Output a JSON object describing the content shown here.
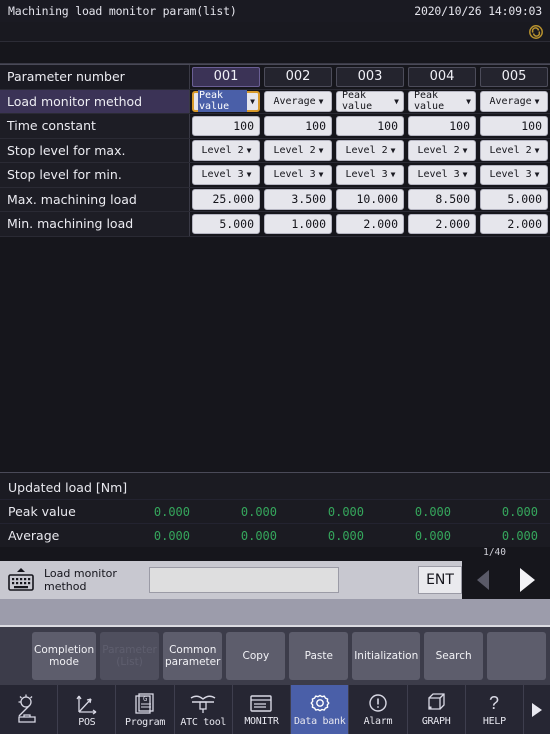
{
  "header": {
    "title": "Machining load monitor param(list)",
    "datetime": "2020/10/26 14:09:03",
    "badge_icon": "swirl-icon"
  },
  "table": {
    "row_labels": [
      "Parameter number",
      "Load monitor method",
      "Time constant",
      "Stop level for max.",
      "Stop level for min.",
      "Max. machining load",
      "Min. machining load"
    ],
    "columns": [
      {
        "number": "001",
        "selected": true,
        "load_monitor_method": "Peak value",
        "time_constant": "100",
        "stop_level_max": "Level 2",
        "stop_level_min": "Level 3",
        "max_machining_load": "25.000",
        "min_machining_load": "5.000"
      },
      {
        "number": "002",
        "selected": false,
        "load_monitor_method": "Average",
        "time_constant": "100",
        "stop_level_max": "Level 2",
        "stop_level_min": "Level 3",
        "max_machining_load": "3.500",
        "min_machining_load": "1.000"
      },
      {
        "number": "003",
        "selected": false,
        "load_monitor_method": "Peak value",
        "time_constant": "100",
        "stop_level_max": "Level 2",
        "stop_level_min": "Level 3",
        "max_machining_load": "10.000",
        "min_machining_load": "2.000"
      },
      {
        "number": "004",
        "selected": false,
        "load_monitor_method": "Peak value",
        "time_constant": "100",
        "stop_level_max": "Level 2",
        "stop_level_min": "Level 3",
        "max_machining_load": "8.500",
        "min_machining_load": "2.000"
      },
      {
        "number": "005",
        "selected": false,
        "load_monitor_method": "Average",
        "time_constant": "100",
        "stop_level_max": "Level 2",
        "stop_level_min": "Level 3",
        "max_machining_load": "5.000",
        "min_machining_load": "2.000"
      }
    ]
  },
  "updated_load": {
    "title": "Updated load [Nm]",
    "rows": [
      {
        "label": "Peak value",
        "values": [
          "0.000",
          "0.000",
          "0.000",
          "0.000",
          "0.000"
        ]
      },
      {
        "label": "Average",
        "values": [
          "0.000",
          "0.000",
          "0.000",
          "0.000",
          "0.000"
        ]
      }
    ],
    "value_color": "#35a65c"
  },
  "pager": {
    "indicator": "1/40"
  },
  "input_bar": {
    "keyboard_icon": "keyboard-icon",
    "label": "Load monitor method",
    "value": "",
    "placeholder": "",
    "enter_label": "ENT",
    "prev_icon": "arrow-left-icon",
    "next_icon": "arrow-right-icon"
  },
  "function_buttons": [
    {
      "label": "Completion mode",
      "disabled": false
    },
    {
      "label": "Parameter (List)",
      "disabled": true
    },
    {
      "label": "Common parameter",
      "disabled": false
    },
    {
      "label": "Copy",
      "disabled": false
    },
    {
      "label": "Paste",
      "disabled": false
    },
    {
      "label": "Initialization",
      "disabled": false
    },
    {
      "label": "Search",
      "disabled": false
    },
    {
      "label": "",
      "disabled": false
    }
  ],
  "nav_items": [
    {
      "label": "",
      "icon": "lamp-tool-icon",
      "active": false
    },
    {
      "label": "POS",
      "icon": "axes-icon",
      "active": false
    },
    {
      "label": "Program",
      "icon": "program-icon",
      "active": false
    },
    {
      "label": "ATC tool",
      "icon": "atc-tool-icon",
      "active": false
    },
    {
      "label": "MONITR",
      "icon": "monitor-icon",
      "active": false
    },
    {
      "label": "Data bank",
      "icon": "gear-icon",
      "active": true
    },
    {
      "label": "Alarm",
      "icon": "alert-icon",
      "active": false
    },
    {
      "label": "GRAPH",
      "icon": "cube-icon",
      "active": false
    },
    {
      "label": "HELP",
      "icon": "question-icon",
      "active": false
    }
  ],
  "colors": {
    "accent_blue": "#4a5fa8",
    "focus_gold": "#d89a2a",
    "row_select_purple": "#3b3356",
    "green_value": "#35a65c"
  }
}
